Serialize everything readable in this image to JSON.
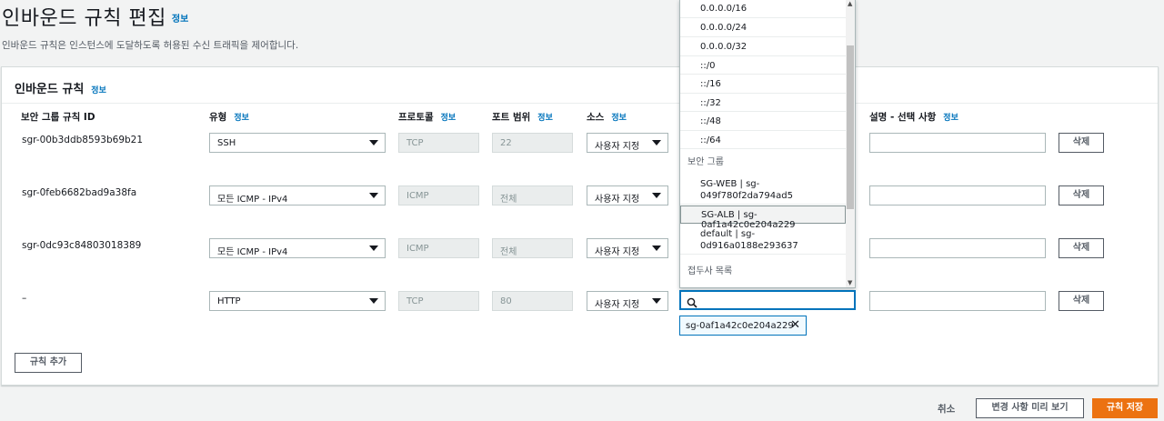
{
  "page": {
    "title": "인바운드 규칙 편집",
    "title_info": "정보",
    "description": "인바운드 규칙은 인스턴스에 도달하도록 허용된 수신 트래픽을 제어합니다."
  },
  "panel": {
    "title": "인바운드 규칙",
    "title_info": "정보",
    "columns": {
      "rule_id": "보안 그룹 규칙 ID",
      "type": "유형",
      "protocol": "프로토콜",
      "port": "포트 범위",
      "source": "소스",
      "description": "설명 - 선택 사항",
      "info": "정보"
    },
    "rows": [
      {
        "id": "sgr-00b3ddb8593b69b21",
        "type": "SSH",
        "protocol": "TCP",
        "port": "22",
        "source": "사용자 지정",
        "delete": "삭제"
      },
      {
        "id": "sgr-0feb6682bad9a38fa",
        "type": "모든 ICMP - IPv4",
        "protocol": "ICMP",
        "port": "전체",
        "source": "사용자 지정",
        "delete": "삭제"
      },
      {
        "id": "sgr-0dc93c84803018389",
        "type": "모든 ICMP - IPv4",
        "protocol": "ICMP",
        "port": "전체",
        "source": "사용자 지정",
        "delete": "삭제"
      },
      {
        "id": "–",
        "type": "HTTP",
        "protocol": "TCP",
        "port": "80",
        "source": "사용자 지정",
        "delete": "삭제"
      }
    ],
    "add_rule": "규칙 추가"
  },
  "dropdown": {
    "cidr_items": [
      "0.0.0.0/16",
      "0.0.0.0/24",
      "0.0.0.0/32",
      "::/0",
      "::/16",
      "::/32",
      "::/48",
      "::/64"
    ],
    "group_label": "보안 그룹",
    "groups": [
      {
        "line1": "SG-WEB | sg-",
        "line2": "049f780f2da794ad5"
      },
      {
        "line1": "SG-ALB | sg-0af1a42c0e204a229",
        "line2": ""
      },
      {
        "line1": "default | sg-",
        "line2": "0d916a0188e293637"
      }
    ],
    "prefix_label": "접두사 목록"
  },
  "search": {
    "value": ""
  },
  "token": {
    "label": "sg-0af1a42c0e204a229"
  },
  "footer": {
    "cancel": "취소",
    "preview": "변경 사항 미리 보기",
    "save": "규칙 저장"
  },
  "colors": {
    "accent": "#0073bb",
    "primary_button": "#ec7211"
  }
}
